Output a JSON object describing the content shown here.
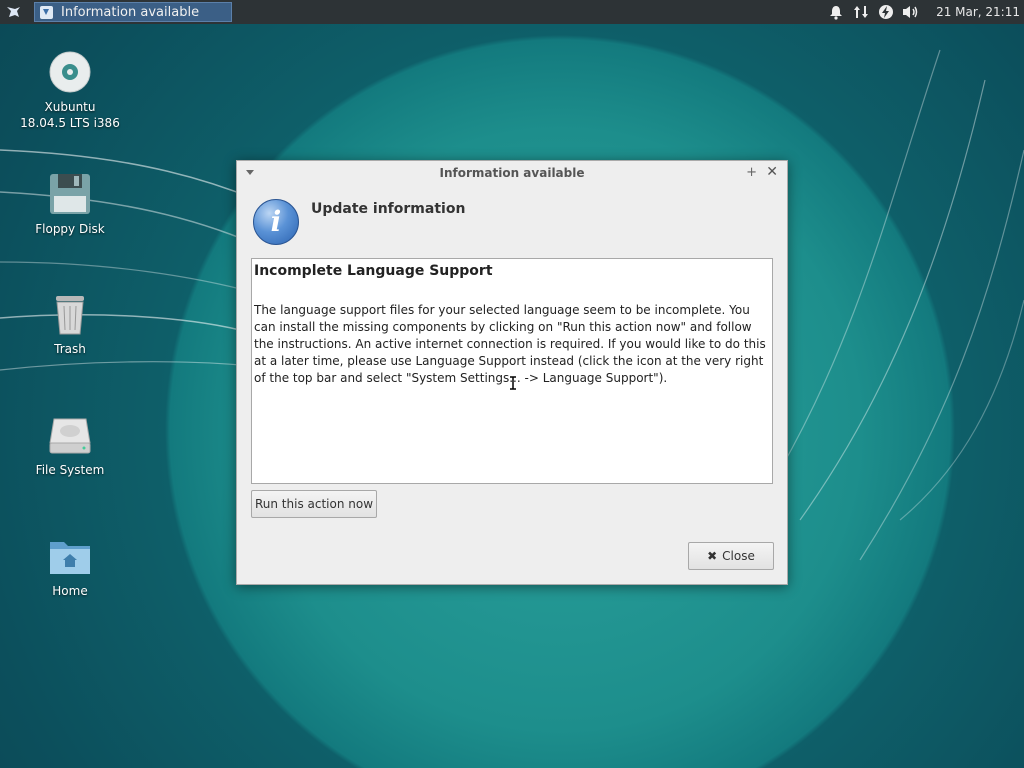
{
  "panel": {
    "task_title": "Information available",
    "clock": "21 Mar, 21:11"
  },
  "desktop": {
    "icons": [
      {
        "label": "Xubuntu\n18.04.5 LTS i386",
        "icon": "cd-disc-icon"
      },
      {
        "label": "Floppy Disk",
        "icon": "floppy-icon"
      },
      {
        "label": "Trash",
        "icon": "trash-icon"
      },
      {
        "label": "File System",
        "icon": "harddrive-icon"
      },
      {
        "label": "Home",
        "icon": "home-folder-icon"
      }
    ]
  },
  "dialog": {
    "title": "Information available",
    "header": "Update information",
    "content_title": "Incomplete Language Support",
    "content_body": "The language support files for your selected language seem to be incomplete. You can install the missing components by clicking on \"Run this action now\" and follow the instructions. An active internet connection is required. If you would like to do this at a later time, please use Language Support instead (click the icon at the very right of the top bar and select \"System Settings... -> Language Support\").",
    "run_button": "Run this action now",
    "close_button": "Close"
  },
  "colors": {
    "panel_bg": "#2d3336",
    "task_active": "#3b5f86",
    "desktop_teal": "#1d8e8c"
  }
}
